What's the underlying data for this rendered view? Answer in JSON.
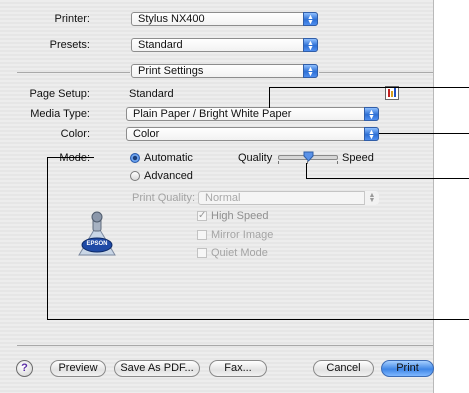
{
  "printer": {
    "label": "Printer:",
    "value": "Stylus NX400"
  },
  "presets": {
    "label": "Presets:",
    "value": "Standard"
  },
  "panel": {
    "value": "Print Settings"
  },
  "page_setup": {
    "label": "Page Setup:",
    "value": "Standard"
  },
  "media_type": {
    "label": "Media Type:",
    "value": "Plain Paper / Bright White Paper"
  },
  "color": {
    "label": "Color:",
    "value": "Color"
  },
  "mode": {
    "label": "Mode:",
    "automatic_label": "Automatic",
    "advanced_label": "Advanced",
    "selected": "Automatic"
  },
  "slider": {
    "left_label": "Quality",
    "right_label": "Speed",
    "level": 0.5
  },
  "print_quality": {
    "label": "Print Quality:",
    "value": "Normal"
  },
  "options": {
    "high_speed": {
      "label": "High Speed",
      "checked": true
    },
    "mirror_image": {
      "label": "Mirror Image",
      "checked": false
    },
    "quiet_mode": {
      "label": "Quiet Mode",
      "checked": false
    }
  },
  "logo": {
    "text": "EPSON"
  },
  "buttons": {
    "help": "?",
    "preview": "Preview",
    "save_pdf": "Save As PDF...",
    "fax": "Fax...",
    "cancel": "Cancel",
    "print": "Print"
  },
  "colors": {
    "accent": "#3f86e6",
    "callout": "#000000"
  }
}
